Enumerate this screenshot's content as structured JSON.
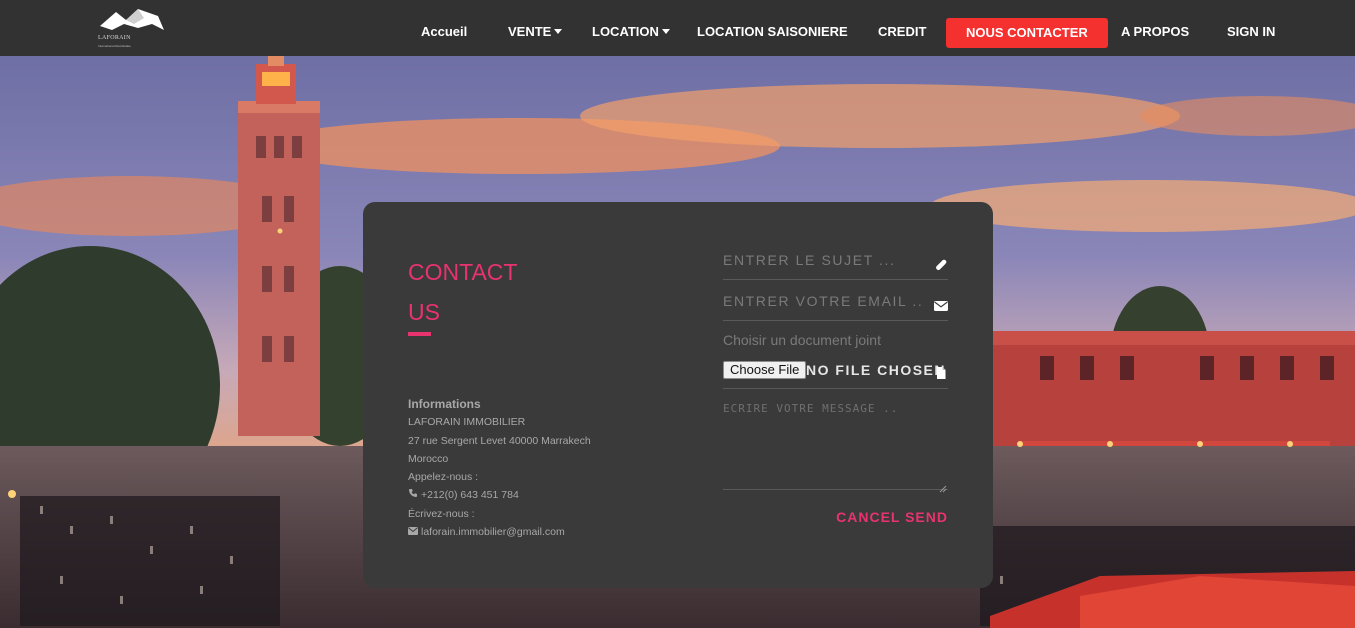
{
  "brand": {
    "logo_name": "LAFORAIN",
    "logo_tagline": "International Real Estate"
  },
  "nav": {
    "items": [
      {
        "label": "Accueil",
        "dropdown": false
      },
      {
        "label": "VENTE",
        "dropdown": true
      },
      {
        "label": "LOCATION",
        "dropdown": true
      },
      {
        "label": "LOCATION SAISONIERE",
        "dropdown": false
      },
      {
        "label": "CREDIT",
        "dropdown": false
      },
      {
        "label": "NOUS CONTACTER",
        "dropdown": false,
        "active": true
      },
      {
        "label": "A PROPOS",
        "dropdown": false
      },
      {
        "label": "SIGN IN",
        "dropdown": false
      }
    ],
    "active_color": "#f5312f"
  },
  "contact": {
    "title_line1": "CONTACT",
    "title_line2": "US",
    "accent_color": "#e8336f",
    "info": {
      "heading": "Informations",
      "company": "LAFORAIN IMMOBILIER",
      "address": "27 rue Sergent Levet 40000 Marrakech",
      "country": "Morocco",
      "call_label": "Appelez-nous :",
      "phone": "+212(0) 643 451 784",
      "write_label": "Écrivez-nous :",
      "email": "laforain.immobilier@gmail.com"
    },
    "form": {
      "subject_placeholder": "ENTRER LE SUJET ...",
      "email_placeholder": "ENTRER VOTRE EMAIL ...",
      "doc_label": "Choisir un document joint",
      "file_button": "Choose File",
      "file_status": "NO FILE CHOSEN",
      "message_placeholder": "ECRIRE VOTRE MESSAGE ..",
      "cancel_label": "CANCEL",
      "send_label": "SEND"
    }
  },
  "icons": {
    "subject": "paperclip-icon",
    "email": "envelope-icon",
    "file": "document-icon",
    "phone": "phone-icon",
    "mail": "envelope-icon"
  }
}
